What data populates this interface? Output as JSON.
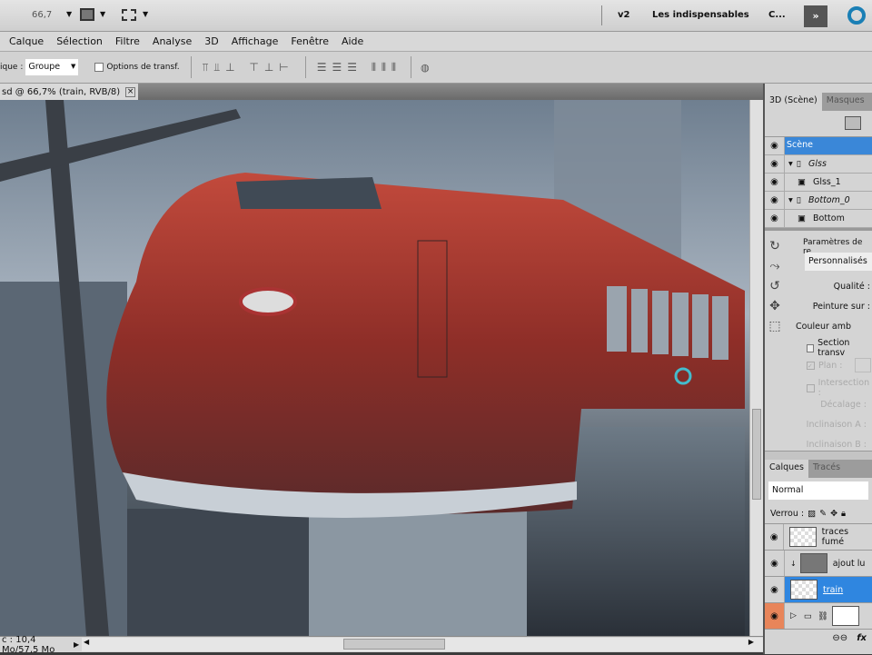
{
  "appbar": {
    "zoom": "66,7",
    "workspace_v2": "v2",
    "workspace_name": "Les indispensables",
    "workspace_more": "C...",
    "expand": "»"
  },
  "menu": [
    "Calque",
    "Sélection",
    "Filtre",
    "Analyse",
    "3D",
    "Affichage",
    "Fenêtre",
    "Aide"
  ],
  "options": {
    "auto_label": "ique :",
    "auto_value": "Groupe",
    "transform_label": "Options de transf."
  },
  "document": {
    "tab_title": "sd @ 66,7% (train, RVB/8)",
    "close": "×"
  },
  "status": {
    "doc_size": "c : 10,4 Mo/57,5 Mo"
  },
  "panel3d": {
    "tabs": [
      "3D (Scène)",
      "Masques"
    ],
    "tree": [
      {
        "label": "Scène",
        "selected": true
      },
      {
        "label": "Glss",
        "italic": true
      },
      {
        "label": "Glss_1"
      },
      {
        "label": "Bottom_0",
        "italic": true
      },
      {
        "label": "Bottom"
      }
    ],
    "render_label": "Paramètres de re",
    "preset": "Personnalisés",
    "quality": "Qualité :",
    "paint_on": "Peinture sur :",
    "ambient": "Couleur amb",
    "cross_section": "Section transv",
    "plane": "Plan :",
    "intersection": "Intersection :",
    "offset": "Décalage :",
    "tilt_a": "Inclinaison A :",
    "tilt_b": "Inclinaison B :"
  },
  "layers": {
    "tabs": [
      "Calques",
      "Tracés"
    ],
    "blend_mode": "Normal",
    "lock_label": "Verrou :",
    "items": [
      {
        "name": "traces fumé"
      },
      {
        "name": "ajout lu"
      },
      {
        "name": "train",
        "selected": true
      },
      {
        "name": ""
      }
    ],
    "fx": "fx"
  }
}
